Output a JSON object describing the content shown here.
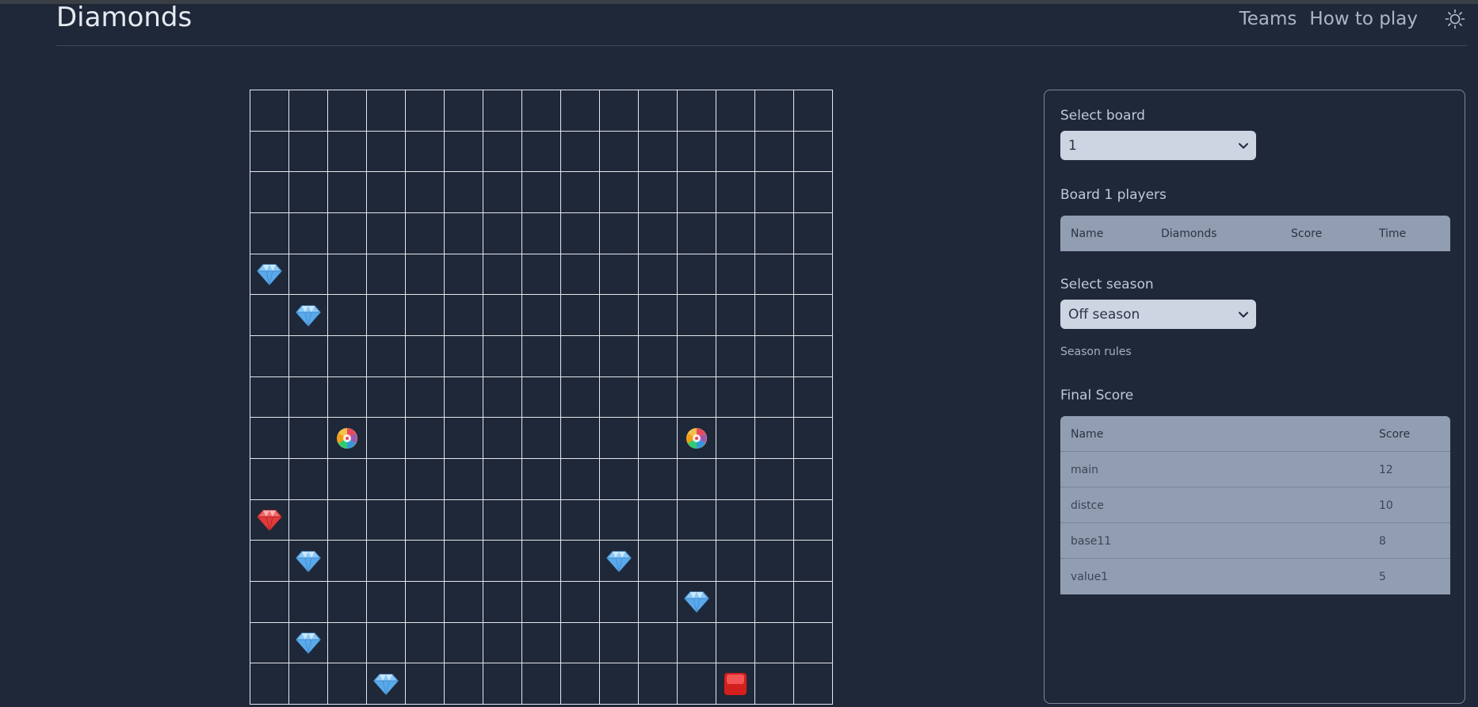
{
  "app": {
    "title": "Diamonds"
  },
  "nav": {
    "teams": "Teams",
    "how_to_play": "How to play",
    "theme_icon": "sun-icon"
  },
  "board": {
    "cols": 15,
    "rows": 15,
    "pieces": [
      {
        "type": "blue-diamond",
        "row": 4,
        "col": 0
      },
      {
        "type": "blue-diamond",
        "row": 5,
        "col": 1
      },
      {
        "type": "teleporter",
        "row": 8,
        "col": 2
      },
      {
        "type": "teleporter",
        "row": 8,
        "col": 11
      },
      {
        "type": "red-diamond",
        "row": 10,
        "col": 0
      },
      {
        "type": "blue-diamond",
        "row": 11,
        "col": 1
      },
      {
        "type": "blue-diamond",
        "row": 11,
        "col": 9
      },
      {
        "type": "blue-diamond",
        "row": 12,
        "col": 11
      },
      {
        "type": "blue-diamond",
        "row": 13,
        "col": 1
      },
      {
        "type": "blue-diamond",
        "row": 14,
        "col": 3
      },
      {
        "type": "red-button",
        "row": 14,
        "col": 12
      }
    ]
  },
  "panel": {
    "select_board_label": "Select board",
    "select_board_value": "1",
    "players_title": "Board 1 players",
    "players_headers": [
      "Name",
      "Diamonds",
      "Score",
      "Time"
    ],
    "select_season_label": "Select season",
    "select_season_value": "Off season",
    "season_rules_link": "Season rules",
    "final_score_title": "Final Score",
    "final_score_headers": [
      "Name",
      "Score"
    ],
    "final_score_rows": [
      {
        "name": "main",
        "score": "12"
      },
      {
        "name": "distce",
        "score": "10"
      },
      {
        "name": "base11",
        "score": "8"
      },
      {
        "name": "value1",
        "score": "5"
      }
    ]
  },
  "colors": {
    "background": "#1f2839",
    "grid_line": "#e4e8ee",
    "select_bg": "#ccd5e1",
    "table_bg": "#919eb2"
  }
}
